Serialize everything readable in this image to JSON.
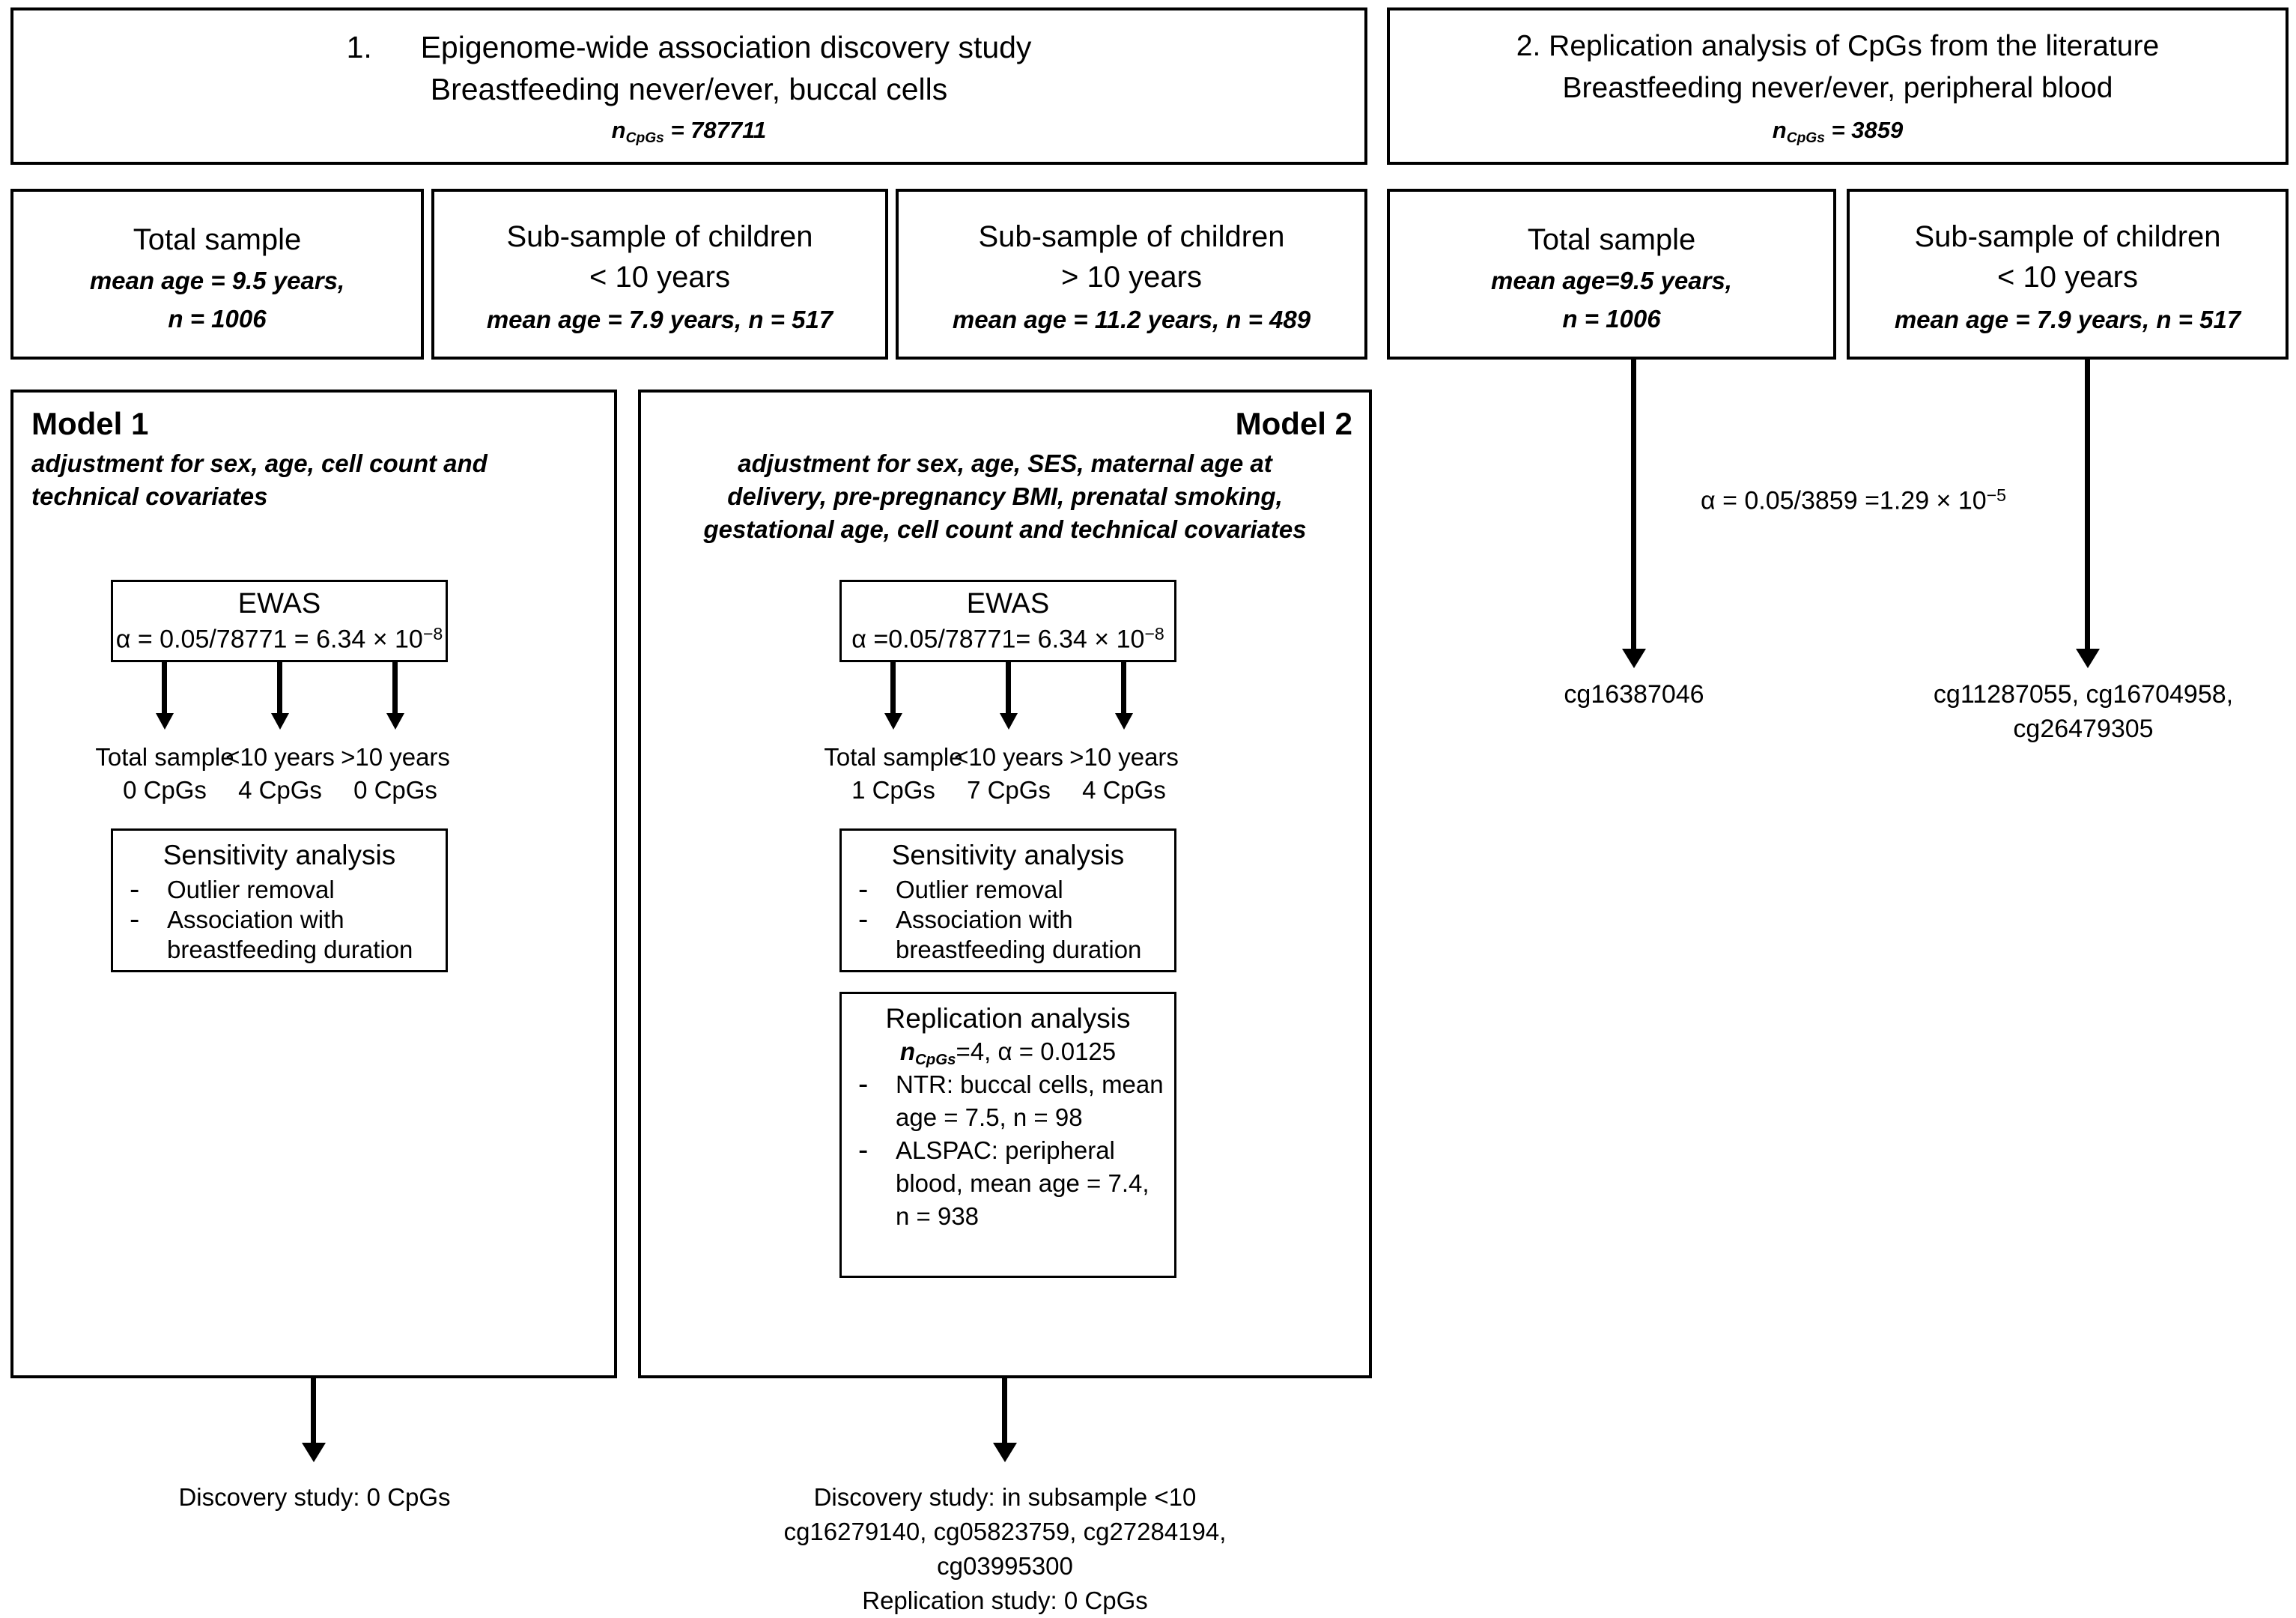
{
  "diagram_title": "Study design flowchart: Epigenome-wide association discovery study and replication analysis",
  "part1": {
    "header": {
      "number": "1.",
      "line1": "Epigenome-wide association discovery study",
      "line2": "Breastfeeding never/ever, buccal cells",
      "n_label": "n",
      "n_sub": "CpGs",
      "n_value": " = 787711"
    },
    "samples": [
      {
        "title": "Total sample",
        "line1": "mean age = 9.5 years,",
        "line2": "n = 1006"
      },
      {
        "title_line1": "Sub-sample of children",
        "title_line2": "< 10 years",
        "line1": "mean age = 7.9 years, n = 517"
      },
      {
        "title_line1": "Sub-sample of children",
        "title_line2": "> 10 years",
        "line1": "mean age = 11.2 years, n = 489"
      }
    ],
    "model1": {
      "title": "Model 1",
      "adjustment_line1": "adjustment for sex, age, cell count and",
      "adjustment_line2": "technical covariates",
      "ewas": {
        "title": "EWAS",
        "alpha_prefix": "α = 0.05/78771 = 6.34 × 10",
        "alpha_exponent": "−8"
      },
      "results": [
        {
          "label": "Total sample",
          "value": "0 CpGs"
        },
        {
          "label": "<10 years",
          "value": "4 CpGs"
        },
        {
          "label": ">10 years",
          "value": "0 CpGs"
        }
      ],
      "sensitivity": {
        "title": "Sensitivity analysis",
        "items": [
          "Outlier removal",
          "Association with",
          "breastfeeding duration"
        ]
      },
      "outcome": "Discovery study: 0 CpGs"
    },
    "model2": {
      "title": "Model 2",
      "adjustment_line1": "adjustment for sex, age, SES, maternal age at",
      "adjustment_line2": "delivery, pre-pregnancy BMI, prenatal smoking,",
      "adjustment_line3": "gestational age, cell count and technical covariates",
      "ewas": {
        "title": "EWAS",
        "alpha_prefix": "α =0.05/78771= 6.34 × 10",
        "alpha_exponent": "−8"
      },
      "results": [
        {
          "label": "Total sample",
          "value": "1 CpGs"
        },
        {
          "label": "<10 years",
          "value": "7 CpGs"
        },
        {
          "label": ">10 years",
          "value": "4 CpGs"
        }
      ],
      "sensitivity": {
        "title": "Sensitivity analysis",
        "items": [
          "Outlier removal",
          "Association with",
          "breastfeeding duration"
        ]
      },
      "replication": {
        "title": "Replication analysis",
        "n_label": "n",
        "n_sub": "CpGs",
        "n_value": "=4, α = 0.0125",
        "items": [
          "NTR: buccal cells, mean",
          "age = 7.5, n = 98",
          "ALSPAC: peripheral",
          "blood, mean age = 7.4,",
          "n = 938"
        ]
      },
      "outcome_line1": "Discovery study: in subsample <10",
      "outcome_line2": "cg16279140, cg05823759, cg27284194,",
      "outcome_line3": "cg03995300",
      "outcome_line4": "Replication study: 0 CpGs"
    }
  },
  "part2": {
    "header": {
      "line1": "2. Replication analysis of CpGs from the literature",
      "line2": "Breastfeeding never/ever, peripheral blood",
      "n_label": "n",
      "n_sub": "CpGs",
      "n_value": " = 3859"
    },
    "samples": [
      {
        "title": "Total sample",
        "line1": "mean age=9.5 years,",
        "line2": "n = 1006"
      },
      {
        "title_line1": "Sub-sample of children",
        "title_line2": "< 10 years",
        "line1": "mean age = 7.9 years, n = 517"
      }
    ],
    "alpha": {
      "prefix": "α = 0.05/3859 =1.29 × 10",
      "exponent": "−5"
    },
    "results": [
      {
        "line1": "cg16387046",
        "line2": ""
      },
      {
        "line1": "cg11287055, cg16704958,",
        "line2": "cg26479305"
      }
    ]
  },
  "colors": {
    "stroke": "#000000",
    "text": "#000000",
    "background": "#ffffff"
  }
}
